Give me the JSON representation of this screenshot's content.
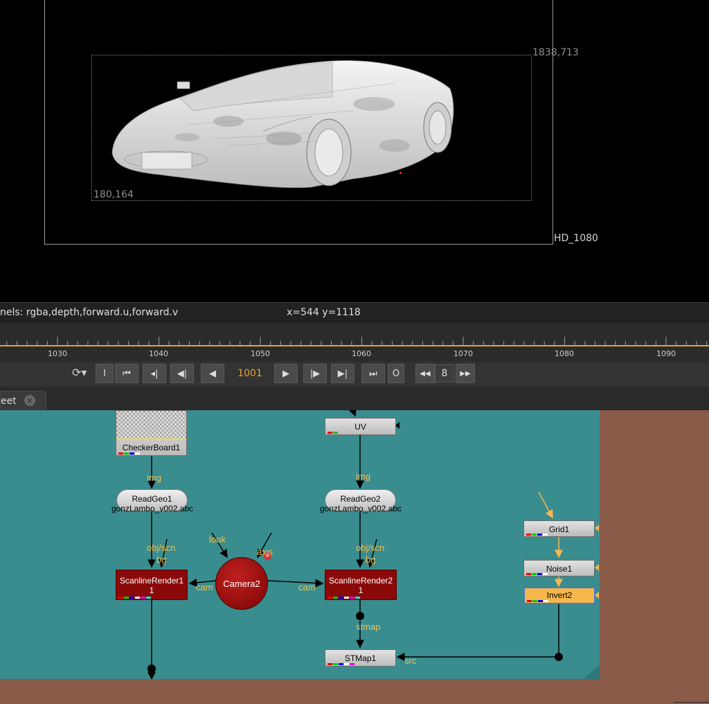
{
  "viewer": {
    "bbox_top_right": "1838,713",
    "bbox_bottom_left": "180,164",
    "format_label": "HD_1080",
    "channels_text": "nels: rgba,depth,forward.u,forward.v",
    "cursor_text": "x=544 y=1118"
  },
  "timeline": {
    "ticks": [
      "1030",
      "1040",
      "1050",
      "1060",
      "1070",
      "1080",
      "1090"
    ]
  },
  "transport": {
    "current_frame": "1001",
    "step": "8",
    "in_label": "I",
    "out_label": "O"
  },
  "tab": {
    "label": "eet",
    "close": "×"
  },
  "nodegraph": {
    "nodes": {
      "checkerboard": "CheckerBoard1",
      "uv": "UV",
      "readgeo1": "ReadGeo1",
      "readgeo1_file": "gonzLambo_v002.abc",
      "readgeo2": "ReadGeo2",
      "readgeo2_file": "gonzLambo_v002.abc",
      "scanline1": "ScanlineRender1",
      "scanline1_sub": "1",
      "scanline2": "ScanlineRender2",
      "scanline2_sub": "1",
      "camera": "Camera2",
      "grid": "Grid1",
      "noise": "Noise1",
      "invert": "Invert2",
      "stmap": "STMap1"
    },
    "pipes": {
      "img1": "img",
      "img2": "img",
      "objscn1": "obj/scn",
      "bg1": "bg",
      "objscn2": "obj/scn",
      "bg2": "bg",
      "look": "look",
      "axis": "axis",
      "cam1": "cam",
      "cam2": "cam",
      "stmap": "stmap",
      "src": "src"
    },
    "camera_badge": "A"
  },
  "colors": {
    "dag_bg": "#3a8d8e",
    "accent": "#f0a030",
    "pipe_label": "#f0c050"
  }
}
